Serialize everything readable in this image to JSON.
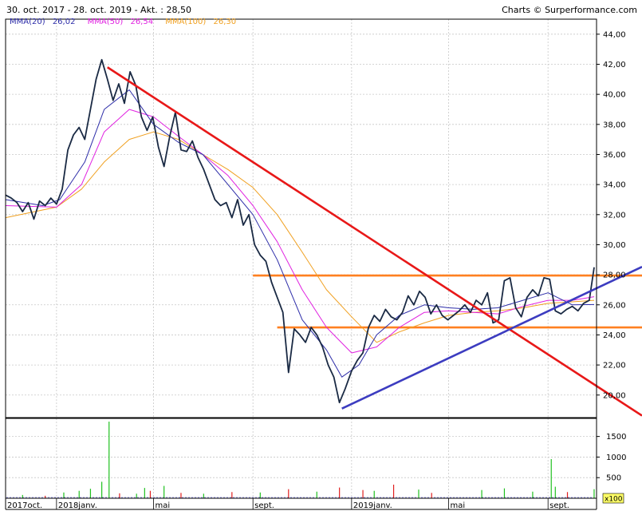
{
  "header": {
    "range": "30. oct. 2017 - 28. oct. 2019 - Akt. : 28,50",
    "credit": "Charts © Surperformance.com"
  },
  "legend": {
    "mma20_label": "MMA(20)",
    "mma20_value": "26,02",
    "mma50_label": "MMA(50)",
    "mma50_value": "26,54",
    "mma100_label": "MMA(100)",
    "mma100_value": "26,30"
  },
  "colors": {
    "price": "#1a2a44",
    "mma20": "#2c2ca8",
    "mma50": "#e020e0",
    "mma100": "#f0a020",
    "resistance_orange": "#ff8020",
    "downtrend_red": "#e81818",
    "uptrend_blue": "#3c3cc0",
    "volume_green": "#20c020",
    "volume_red": "#e02020",
    "volume_blue": "#2020c0",
    "grid": "#c8c8c8"
  },
  "volume_unit_label": "x100",
  "chart_data": [
    {
      "type": "line",
      "x_start": "2017-10-30",
      "x_end": "2019-10-28",
      "ylim": [
        18.5,
        45
      ],
      "yticks": [
        20,
        22,
        24,
        26,
        28,
        30,
        32,
        34,
        36,
        38,
        40,
        42,
        44
      ],
      "ytick_labels": [
        "20,00",
        "22,00",
        "24,00",
        "26,00",
        "28,00",
        "30,00",
        "32,00",
        "34,00",
        "36,00",
        "38,00",
        "40,00",
        "42,00",
        "44,00"
      ],
      "x_tick_labels": [
        "2017oct.",
        "2018janv.",
        "mai",
        "sept.",
        "2019janv.",
        "mai",
        "sept."
      ],
      "x_tick_dates": [
        "2017-10-30",
        "2018-01-01",
        "2018-05-01",
        "2018-09-01",
        "2019-01-01",
        "2019-05-01",
        "2019-09-01"
      ],
      "grid": true,
      "series": [
        {
          "name": "Price",
          "role": "price",
          "points": [
            [
              "2017-10-30",
              33.3
            ],
            [
              "2017-11-06",
              33.1
            ],
            [
              "2017-11-13",
              32.8
            ],
            [
              "2017-11-20",
              32.2
            ],
            [
              "2017-11-27",
              32.8
            ],
            [
              "2017-12-04",
              31.7
            ],
            [
              "2017-12-11",
              32.9
            ],
            [
              "2017-12-18",
              32.6
            ],
            [
              "2017-12-25",
              33.1
            ],
            [
              "2018-01-01",
              32.7
            ],
            [
              "2018-01-08",
              33.7
            ],
            [
              "2018-01-15",
              36.3
            ],
            [
              "2018-01-22",
              37.3
            ],
            [
              "2018-01-29",
              37.8
            ],
            [
              "2018-02-05",
              37.0
            ],
            [
              "2018-02-12",
              39.0
            ],
            [
              "2018-02-19",
              41.0
            ],
            [
              "2018-02-26",
              42.3
            ],
            [
              "2018-03-05",
              41.0
            ],
            [
              "2018-03-12",
              39.6
            ],
            [
              "2018-03-19",
              40.7
            ],
            [
              "2018-03-26",
              39.4
            ],
            [
              "2018-04-02",
              41.5
            ],
            [
              "2018-04-09",
              40.6
            ],
            [
              "2018-04-16",
              38.5
            ],
            [
              "2018-04-23",
              37.6
            ],
            [
              "2018-04-30",
              38.5
            ],
            [
              "2018-05-07",
              36.5
            ],
            [
              "2018-05-14",
              35.2
            ],
            [
              "2018-05-21",
              37.2
            ],
            [
              "2018-05-28",
              38.8
            ],
            [
              "2018-06-04",
              36.3
            ],
            [
              "2018-06-11",
              36.2
            ],
            [
              "2018-06-18",
              36.9
            ],
            [
              "2018-06-25",
              35.8
            ],
            [
              "2018-07-02",
              35.0
            ],
            [
              "2018-07-09",
              34.0
            ],
            [
              "2018-07-16",
              33.0
            ],
            [
              "2018-07-23",
              32.6
            ],
            [
              "2018-07-30",
              32.8
            ],
            [
              "2018-08-06",
              31.8
            ],
            [
              "2018-08-13",
              33.0
            ],
            [
              "2018-08-20",
              31.3
            ],
            [
              "2018-08-27",
              32.0
            ],
            [
              "2018-09-03",
              30.0
            ],
            [
              "2018-09-10",
              29.3
            ],
            [
              "2018-09-17",
              28.9
            ],
            [
              "2018-09-24",
              27.5
            ],
            [
              "2018-10-01",
              26.5
            ],
            [
              "2018-10-08",
              25.5
            ],
            [
              "2018-10-15",
              21.5
            ],
            [
              "2018-10-22",
              24.4
            ],
            [
              "2018-10-29",
              24.0
            ],
            [
              "2018-11-05",
              23.5
            ],
            [
              "2018-11-12",
              24.5
            ],
            [
              "2018-11-19",
              24.0
            ],
            [
              "2018-11-26",
              23.2
            ],
            [
              "2018-12-03",
              22.0
            ],
            [
              "2018-12-10",
              21.2
            ],
            [
              "2018-12-17",
              19.5
            ],
            [
              "2018-12-24",
              20.4
            ],
            [
              "2019-01-01",
              21.6
            ],
            [
              "2019-01-08",
              22.3
            ],
            [
              "2019-01-15",
              22.8
            ],
            [
              "2019-01-22",
              24.5
            ],
            [
              "2019-01-29",
              25.3
            ],
            [
              "2019-02-05",
              24.9
            ],
            [
              "2019-02-12",
              25.7
            ],
            [
              "2019-02-19",
              25.2
            ],
            [
              "2019-02-26",
              25.0
            ],
            [
              "2019-03-05",
              25.5
            ],
            [
              "2019-03-12",
              26.6
            ],
            [
              "2019-03-19",
              26.0
            ],
            [
              "2019-03-26",
              26.9
            ],
            [
              "2019-04-02",
              26.5
            ],
            [
              "2019-04-09",
              25.4
            ],
            [
              "2019-04-16",
              26.0
            ],
            [
              "2019-04-23",
              25.3
            ],
            [
              "2019-04-30",
              25.0
            ],
            [
              "2019-05-07",
              25.3
            ],
            [
              "2019-05-14",
              25.6
            ],
            [
              "2019-05-21",
              26.0
            ],
            [
              "2019-05-28",
              25.5
            ],
            [
              "2019-06-04",
              26.3
            ],
            [
              "2019-06-11",
              26.0
            ],
            [
              "2019-06-18",
              26.8
            ],
            [
              "2019-06-25",
              24.8
            ],
            [
              "2019-07-02",
              25.0
            ],
            [
              "2019-07-09",
              27.6
            ],
            [
              "2019-07-16",
              27.8
            ],
            [
              "2019-07-23",
              25.8
            ],
            [
              "2019-07-30",
              25.2
            ],
            [
              "2019-08-06",
              26.5
            ],
            [
              "2019-08-13",
              27.0
            ],
            [
              "2019-08-20",
              26.6
            ],
            [
              "2019-08-27",
              27.8
            ],
            [
              "2019-09-03",
              27.7
            ],
            [
              "2019-09-10",
              25.6
            ],
            [
              "2019-09-17",
              25.4
            ],
            [
              "2019-09-24",
              25.7
            ],
            [
              "2019-10-01",
              25.9
            ],
            [
              "2019-10-08",
              25.6
            ],
            [
              "2019-10-15",
              26.1
            ],
            [
              "2019-10-22",
              26.3
            ],
            [
              "2019-10-28",
              28.5
            ]
          ]
        },
        {
          "name": "MMA(20)",
          "role": "mma20",
          "points": [
            [
              "2017-10-30",
              33.0
            ],
            [
              "2017-12-15",
              32.6
            ],
            [
              "2018-01-05",
              33.0
            ],
            [
              "2018-02-05",
              35.5
            ],
            [
              "2018-03-01",
              39.0
            ],
            [
              "2018-04-01",
              40.3
            ],
            [
              "2018-05-01",
              38.0
            ],
            [
              "2018-06-01",
              36.8
            ],
            [
              "2018-07-01",
              36.0
            ],
            [
              "2018-08-01",
              34.0
            ],
            [
              "2018-09-01",
              32.0
            ],
            [
              "2018-10-01",
              29.0
            ],
            [
              "2018-11-01",
              25.0
            ],
            [
              "2018-12-01",
              23.0
            ],
            [
              "2018-12-20",
              21.2
            ],
            [
              "2019-01-10",
              22.0
            ],
            [
              "2019-02-01",
              24.0
            ],
            [
              "2019-03-01",
              25.3
            ],
            [
              "2019-04-01",
              26.0
            ],
            [
              "2019-05-01",
              25.8
            ],
            [
              "2019-06-01",
              25.7
            ],
            [
              "2019-07-01",
              25.8
            ],
            [
              "2019-08-01",
              26.3
            ],
            [
              "2019-09-01",
              26.8
            ],
            [
              "2019-10-01",
              26.0
            ],
            [
              "2019-10-28",
              26.02
            ]
          ]
        },
        {
          "name": "MMA(50)",
          "role": "mma50",
          "points": [
            [
              "2017-10-30",
              32.6
            ],
            [
              "2018-01-01",
              32.5
            ],
            [
              "2018-02-01",
              34.0
            ],
            [
              "2018-03-01",
              37.5
            ],
            [
              "2018-04-01",
              39.0
            ],
            [
              "2018-05-01",
              38.5
            ],
            [
              "2018-06-01",
              37.2
            ],
            [
              "2018-07-01",
              36.0
            ],
            [
              "2018-08-01",
              34.6
            ],
            [
              "2018-09-01",
              32.6
            ],
            [
              "2018-10-01",
              30.2
            ],
            [
              "2018-11-01",
              27.0
            ],
            [
              "2018-12-01",
              24.5
            ],
            [
              "2019-01-01",
              22.8
            ],
            [
              "2019-02-01",
              23.2
            ],
            [
              "2019-03-01",
              24.5
            ],
            [
              "2019-04-01",
              25.5
            ],
            [
              "2019-05-01",
              25.6
            ],
            [
              "2019-06-01",
              25.5
            ],
            [
              "2019-07-01",
              25.4
            ],
            [
              "2019-08-01",
              25.9
            ],
            [
              "2019-09-01",
              26.3
            ],
            [
              "2019-10-01",
              26.3
            ],
            [
              "2019-10-28",
              26.54
            ]
          ]
        },
        {
          "name": "MMA(100)",
          "role": "mma100",
          "points": [
            [
              "2017-10-30",
              31.8
            ],
            [
              "2018-01-01",
              32.5
            ],
            [
              "2018-02-01",
              33.7
            ],
            [
              "2018-03-01",
              35.5
            ],
            [
              "2018-04-01",
              37.0
            ],
            [
              "2018-05-01",
              37.5
            ],
            [
              "2018-06-01",
              37.0
            ],
            [
              "2018-07-01",
              36.0
            ],
            [
              "2018-08-01",
              35.0
            ],
            [
              "2018-09-01",
              33.8
            ],
            [
              "2018-10-01",
              32.0
            ],
            [
              "2018-11-01",
              29.5
            ],
            [
              "2018-12-01",
              27.0
            ],
            [
              "2019-01-01",
              25.2
            ],
            [
              "2019-02-01",
              23.5
            ],
            [
              "2019-03-01",
              24.2
            ],
            [
              "2019-04-01",
              24.8
            ],
            [
              "2019-05-01",
              25.3
            ],
            [
              "2019-06-01",
              25.5
            ],
            [
              "2019-07-01",
              25.6
            ],
            [
              "2019-08-01",
              25.8
            ],
            [
              "2019-09-01",
              26.1
            ],
            [
              "2019-10-01",
              26.2
            ],
            [
              "2019-10-28",
              26.3
            ]
          ]
        }
      ],
      "trendlines": [
        {
          "role": "resistance",
          "color_key": "resistance_orange",
          "points": [
            [
              "2018-09-01",
              27.95
            ],
            [
              "2019-10-31",
              27.95
            ]
          ]
        },
        {
          "role": "support",
          "color_key": "resistance_orange",
          "points": [
            [
              "2018-10-01",
              24.5
            ],
            [
              "2019-10-31",
              24.5
            ]
          ]
        },
        {
          "role": "downtrend",
          "color_key": "downtrend_red",
          "points": [
            [
              "2018-03-05",
              41.8
            ],
            [
              "2019-10-31",
              20.6
            ]
          ]
        },
        {
          "role": "uptrend",
          "color_key": "uptrend_blue",
          "points": [
            [
              "2018-12-20",
              19.1
            ],
            [
              "2019-10-31",
              27.1
            ]
          ]
        }
      ]
    },
    {
      "type": "bar",
      "x_start": "2017-10-30",
      "x_end": "2019-10-28",
      "ylim": [
        0,
        1900
      ],
      "yticks": [
        500,
        1000,
        1500
      ],
      "ytick_labels": [
        "500",
        "1000",
        "1500"
      ],
      "unit": "x100",
      "bars": [
        [
          "2017-11-20",
          80,
          "g"
        ],
        [
          "2017-12-18",
          60,
          "r"
        ],
        [
          "2018-01-10",
          140,
          "g"
        ],
        [
          "2018-01-29",
          180,
          "g"
        ],
        [
          "2018-02-12",
          230,
          "g"
        ],
        [
          "2018-02-26",
          400,
          "g"
        ],
        [
          "2018-03-07",
          1860,
          "g"
        ],
        [
          "2018-03-20",
          120,
          "r"
        ],
        [
          "2018-04-10",
          110,
          "g"
        ],
        [
          "2018-04-20",
          250,
          "g"
        ],
        [
          "2018-04-27",
          180,
          "r"
        ],
        [
          "2018-05-14",
          300,
          "g"
        ],
        [
          "2018-06-04",
          130,
          "r"
        ],
        [
          "2018-07-02",
          110,
          "g"
        ],
        [
          "2018-08-06",
          150,
          "r"
        ],
        [
          "2018-09-10",
          140,
          "g"
        ],
        [
          "2018-10-15",
          220,
          "r"
        ],
        [
          "2018-11-19",
          160,
          "g"
        ],
        [
          "2018-12-17",
          260,
          "r"
        ],
        [
          "2019-01-15",
          200,
          "r"
        ],
        [
          "2019-01-29",
          180,
          "g"
        ],
        [
          "2019-02-22",
          330,
          "r"
        ],
        [
          "2019-03-25",
          210,
          "g"
        ],
        [
          "2019-04-10",
          130,
          "r"
        ],
        [
          "2019-06-11",
          200,
          "g"
        ],
        [
          "2019-07-09",
          240,
          "g"
        ],
        [
          "2019-08-13",
          160,
          "g"
        ],
        [
          "2019-09-05",
          950,
          "g"
        ],
        [
          "2019-09-10",
          280,
          "g"
        ],
        [
          "2019-09-25",
          150,
          "r"
        ],
        [
          "2019-10-28",
          220,
          "g"
        ]
      ]
    }
  ]
}
